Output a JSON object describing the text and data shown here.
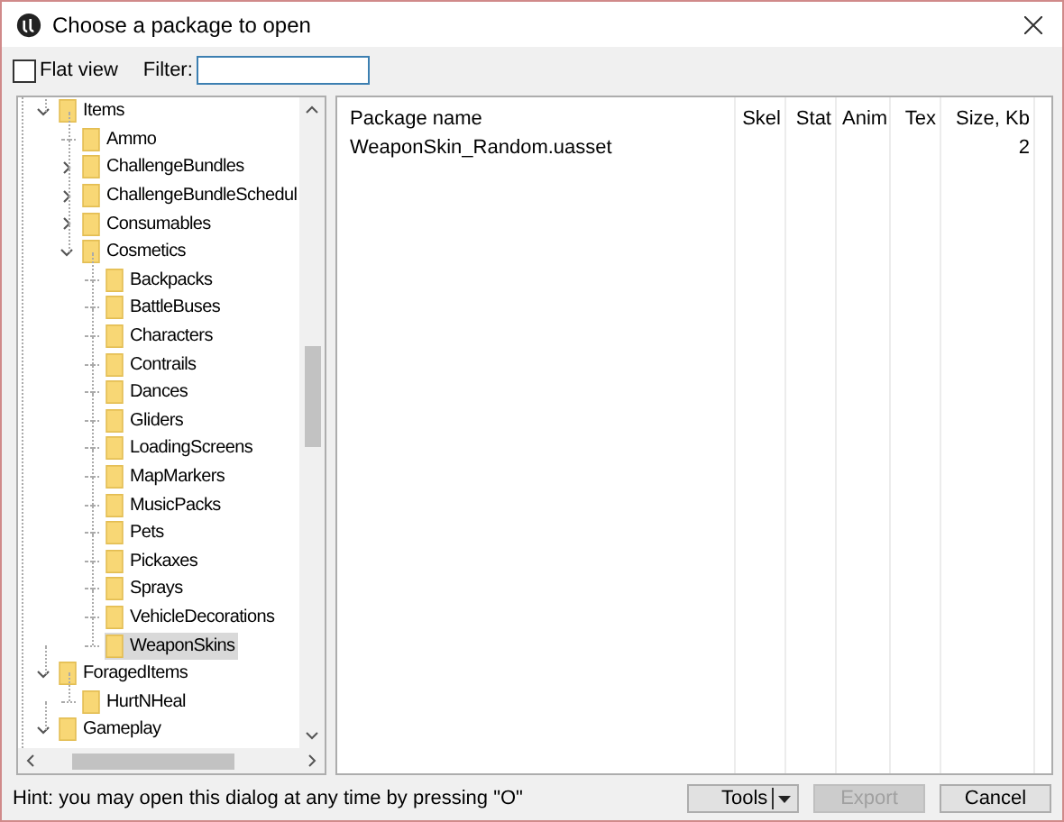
{
  "window": {
    "title": "Choose a package to open"
  },
  "toolbar": {
    "flat_view": {
      "label": "Flat view",
      "checked": false
    },
    "filter": {
      "label": "Filter:"
    }
  },
  "tree": [
    {
      "label": "Items",
      "expanded": true,
      "selected": false,
      "children": [
        {
          "label": "Ammo",
          "selected": false
        },
        {
          "label": "ChallengeBundles",
          "expanded": false,
          "selected": false
        },
        {
          "label": "ChallengeBundleSchedul",
          "expanded": false,
          "selected": false
        },
        {
          "label": "Consumables",
          "expanded": false,
          "selected": false
        },
        {
          "label": "Cosmetics",
          "expanded": true,
          "selected": false,
          "children": [
            {
              "label": "Backpacks",
              "selected": false
            },
            {
              "label": "BattleBuses",
              "selected": false
            },
            {
              "label": "Characters",
              "selected": false
            },
            {
              "label": "Contrails",
              "selected": false
            },
            {
              "label": "Dances",
              "selected": false
            },
            {
              "label": "Gliders",
              "selected": false
            },
            {
              "label": "LoadingScreens",
              "selected": false
            },
            {
              "label": "MapMarkers",
              "selected": false
            },
            {
              "label": "MusicPacks",
              "selected": false
            },
            {
              "label": "Pets",
              "selected": false
            },
            {
              "label": "Pickaxes",
              "selected": false
            },
            {
              "label": "Sprays",
              "selected": false
            },
            {
              "label": "VehicleDecorations",
              "selected": false
            },
            {
              "label": "WeaponSkins",
              "selected": true
            }
          ]
        }
      ]
    },
    {
      "label": "ForagedItems",
      "expanded": true,
      "selected": false,
      "children": [
        {
          "label": "HurtNHeal",
          "selected": false
        }
      ]
    },
    {
      "label": "Gameplay",
      "expanded": true,
      "selected": false
    }
  ],
  "table": {
    "columns": [
      "Package name",
      "Skel",
      "Stat",
      "Anim",
      "Tex",
      "Size, Kb"
    ],
    "rows": [
      {
        "cells": [
          "WeaponSkin_Random.uasset",
          null,
          null,
          null,
          null,
          "2"
        ]
      }
    ]
  },
  "status_bar": {
    "hint": "Hint: you may open this dialog at any time by pressing \"O\""
  },
  "buttons": [
    {
      "label": "Tools",
      "kind": "dropdown",
      "disabled": false
    },
    {
      "label": "Export",
      "kind": "plain",
      "disabled": true
    },
    {
      "label": "Cancel",
      "kind": "plain",
      "disabled": false
    }
  ]
}
